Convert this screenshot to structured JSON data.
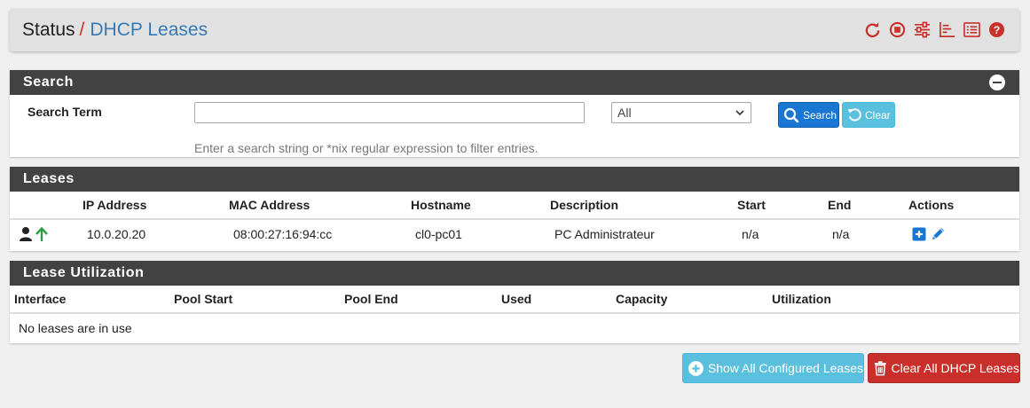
{
  "header": {
    "breadcrumb_parent": "Status",
    "breadcrumb_sep": "/",
    "breadcrumb_current": "DHCP Leases",
    "icons": [
      "reload-icon",
      "stop-icon",
      "sliders-icon",
      "bar-chart-icon",
      "list-icon",
      "help-icon"
    ]
  },
  "search": {
    "title": "Search",
    "term_label": "Search Term",
    "term_value": "",
    "filter_value": "All",
    "search_button": "Search",
    "clear_button": "Clear",
    "help_text": "Enter a search string or *nix regular expression to filter entries."
  },
  "leases": {
    "title": "Leases",
    "columns": [
      "IP Address",
      "MAC Address",
      "Hostname",
      "Description",
      "Start",
      "End",
      "Actions"
    ],
    "rows": [
      {
        "ip": "10.0.20.20",
        "mac": "08:00:27:16:94:cc",
        "hostname": "cl0-pc01",
        "description": "PC Administrateur",
        "start": "n/a",
        "end": "n/a"
      }
    ]
  },
  "utilization": {
    "title": "Lease Utilization",
    "columns": [
      "Interface",
      "Pool Start",
      "Pool End",
      "Used",
      "Capacity",
      "Utilization"
    ],
    "empty_text": "No leases are in use"
  },
  "actions": {
    "show_all": "Show All Configured Leases",
    "clear_all": "Clear All DHCP Leases"
  },
  "colors": {
    "accent_red": "#c9302c",
    "link_blue": "#337ab7",
    "primary_blue": "#1976d2",
    "info_cyan": "#5bc0de",
    "panel_dark": "#424242",
    "online_green": "#2e9e3e"
  }
}
